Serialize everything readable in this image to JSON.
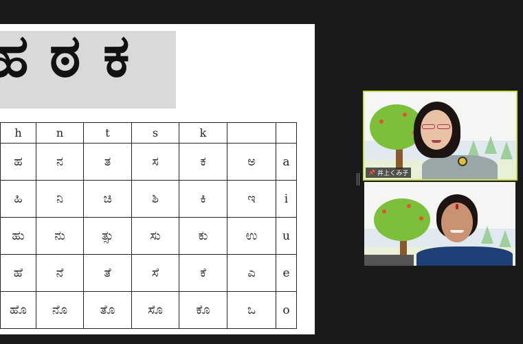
{
  "share": {
    "banner_letters": [
      "ಹ",
      "ಠ",
      "ಕ"
    ],
    "chart": {
      "headers": [
        "h",
        "n",
        "t",
        "s",
        "k",
        "",
        ""
      ],
      "rows": [
        {
          "cells": [
            "ಹ",
            "ನ",
            "ತ",
            "ಸ",
            "ಕ",
            "ಅ"
          ],
          "vowel": "a"
        },
        {
          "cells": [
            "ಹಿ",
            "ನಿ",
            "ಚಿ",
            "ಶಿ",
            "ಕಿ",
            "ಇ"
          ],
          "vowel": "i"
        },
        {
          "cells": [
            "ಹು",
            "ನು",
            "ತ್ಸು",
            "ಸು",
            "ಕು",
            "ಉ"
          ],
          "vowel": "u"
        },
        {
          "cells": [
            "ಹೆ",
            "ನೆ",
            "ತೆ",
            "ಸೆ",
            "ಕೆ",
            "ಎ"
          ],
          "vowel": "e"
        },
        {
          "cells": [
            "ಹೊ",
            "ನೊ",
            "ತೊ",
            "ಸೊ",
            "ಕೊ",
            "ಒ"
          ],
          "vowel": "o"
        }
      ]
    }
  },
  "participants": [
    {
      "name": "井上くみ子",
      "active_speaker": true,
      "mic_icon": "pin-icon"
    },
    {
      "name": "",
      "active_speaker": false
    }
  ],
  "colors": {
    "active_border": "#c9df4a",
    "background": "#1a1a1a"
  }
}
